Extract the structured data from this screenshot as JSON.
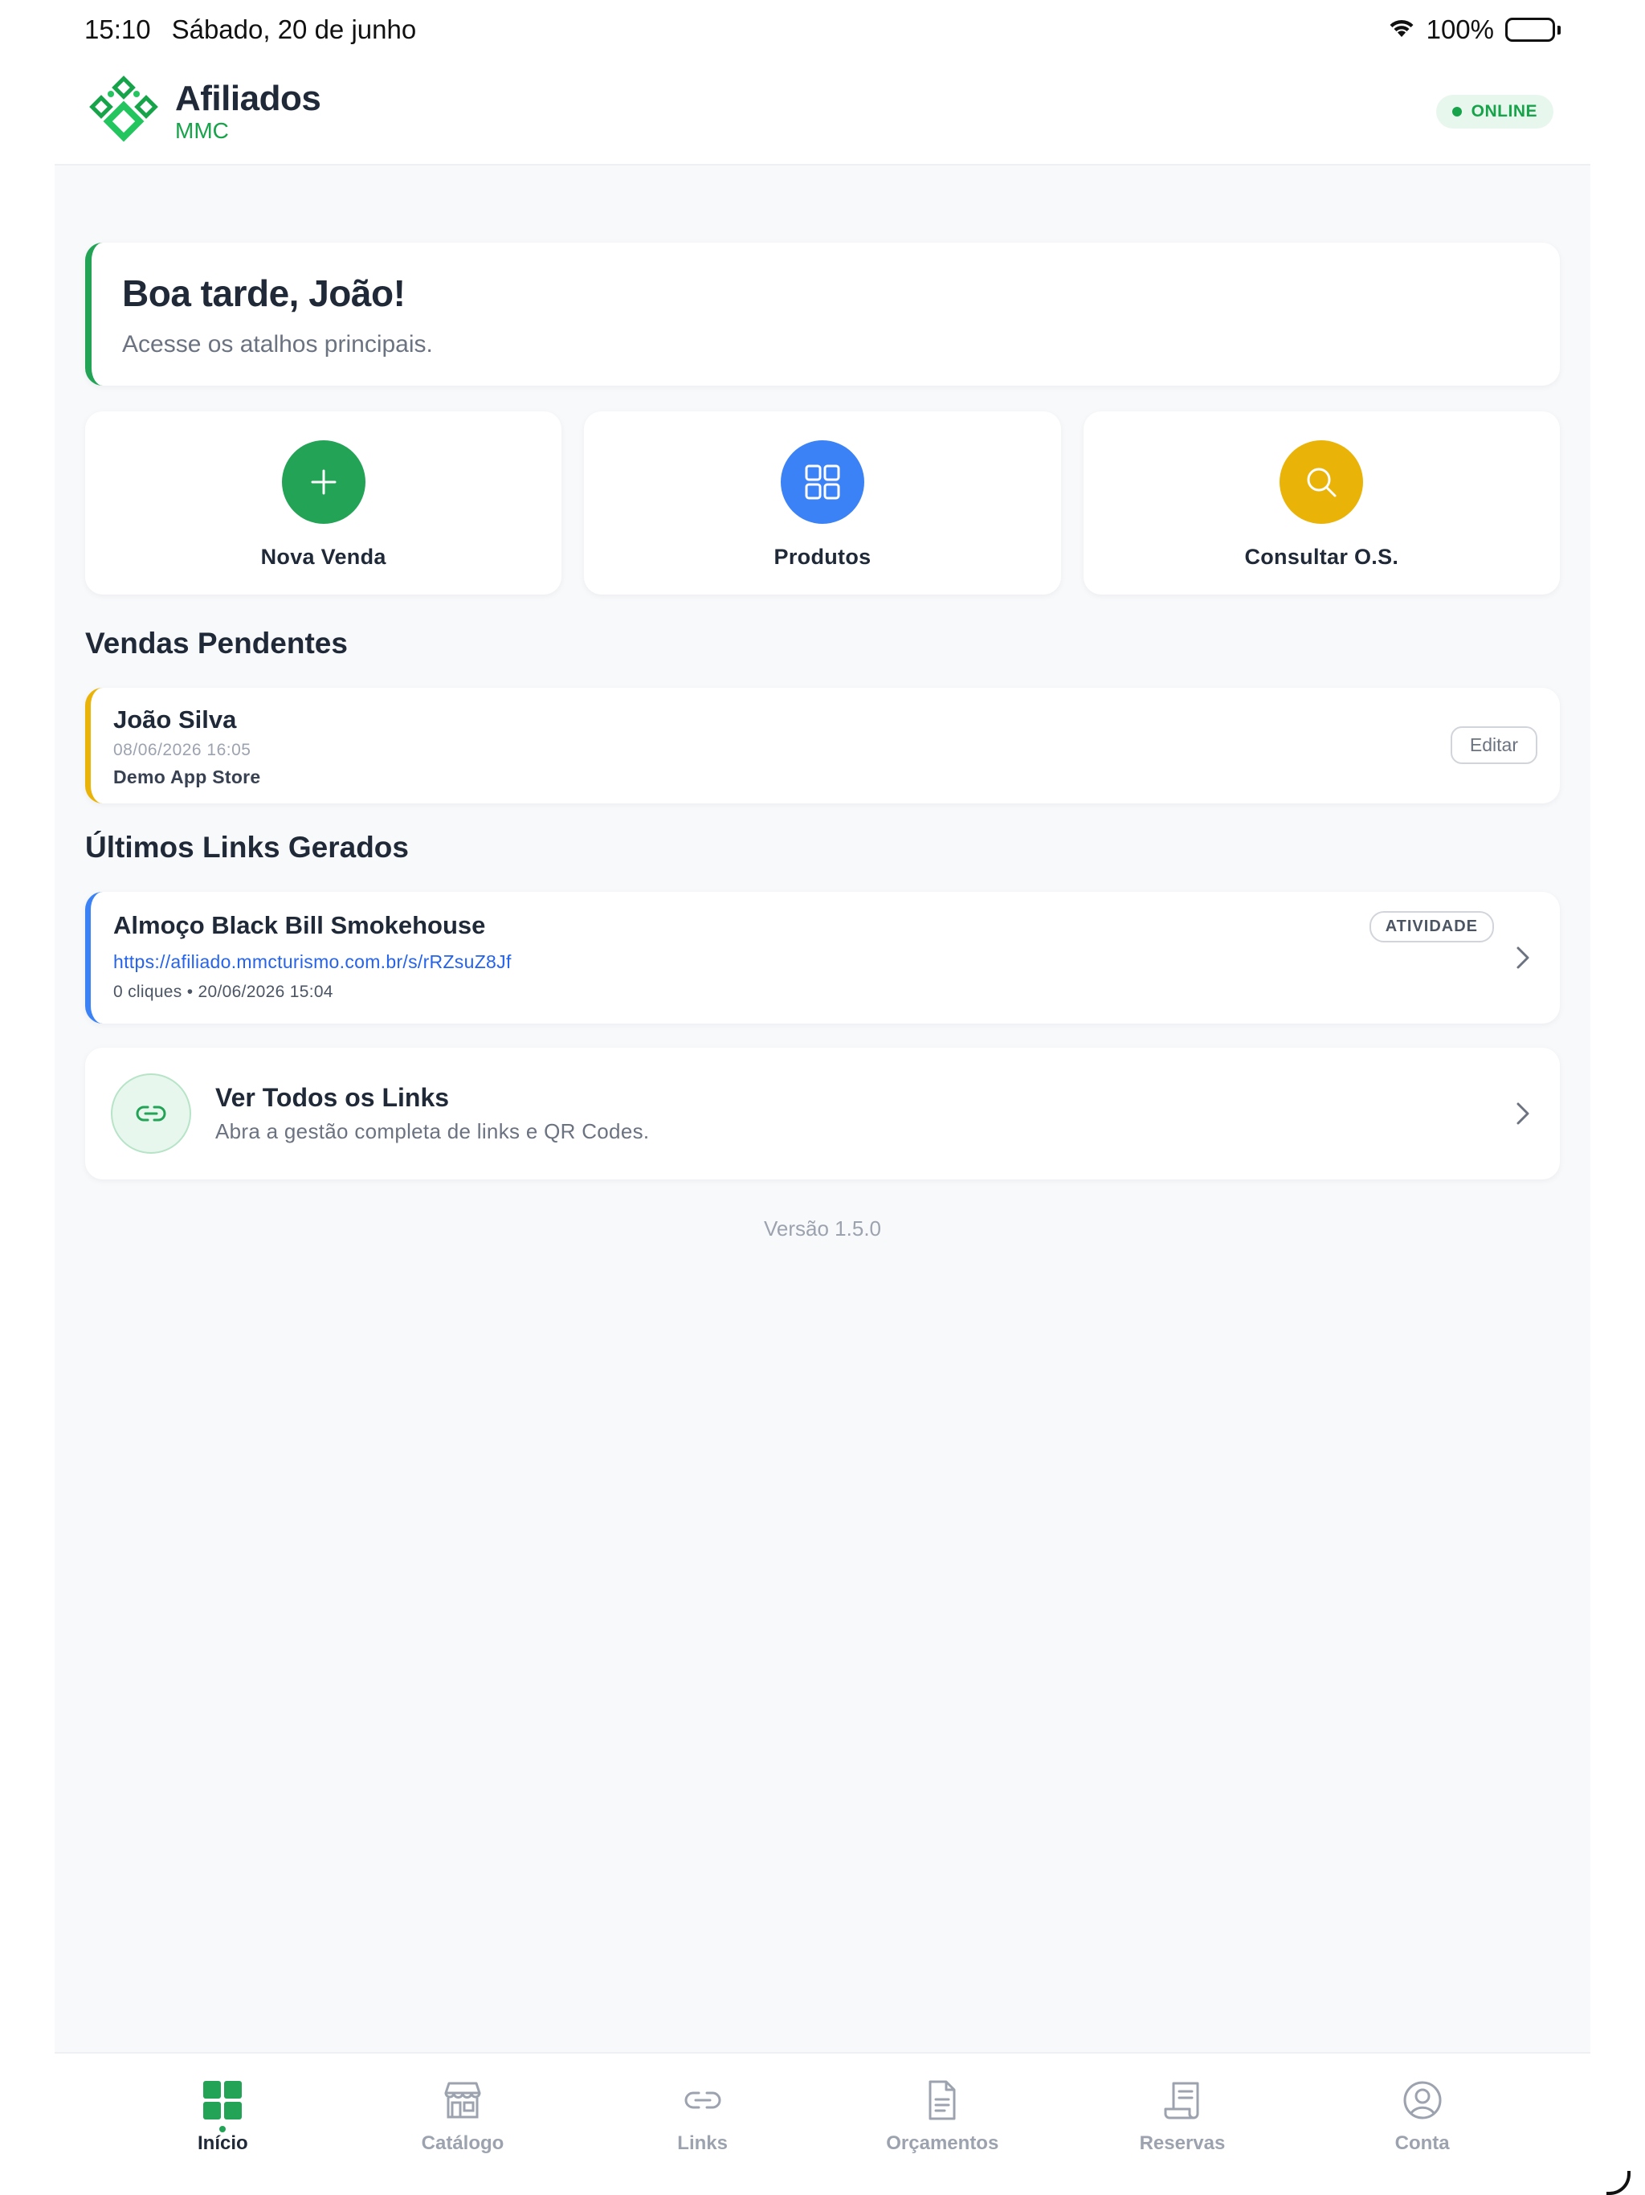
{
  "status_bar": {
    "time": "15:10",
    "date": "Sábado, 20 de junho",
    "battery": "100%"
  },
  "header": {
    "title": "Afiliados",
    "subtitle": "MMC",
    "status": "ONLINE"
  },
  "greeting": {
    "title": "Boa tarde, João!",
    "subtitle": "Acesse os atalhos principais."
  },
  "shortcuts": [
    {
      "label": "Nova Venda",
      "icon": "plus-icon",
      "color": "#22a355"
    },
    {
      "label": "Produtos",
      "icon": "grid-icon",
      "color": "#3b82f6"
    },
    {
      "label": "Consultar O.S.",
      "icon": "search-icon",
      "color": "#eab308"
    }
  ],
  "pending": {
    "section_title": "Vendas Pendentes",
    "items": [
      {
        "name": "João Silva",
        "date": "08/06/2026 16:05",
        "store": "Demo App Store",
        "action": "Editar"
      }
    ]
  },
  "links": {
    "section_title": "Últimos Links Gerados",
    "items": [
      {
        "title": "Almoço Black Bill Smokehouse",
        "url": "https://afiliado.mmcturismo.com.br/s/rRZsuZ8Jf",
        "meta": "0 cliques • 20/06/2026 15:04",
        "badge": "ATIVIDADE"
      }
    ],
    "view_all": {
      "title": "Ver Todos os Links",
      "subtitle": "Abra a gestão completa de links e QR Codes."
    }
  },
  "version": "Versão 1.5.0",
  "tabs": [
    {
      "label": "Início",
      "icon": "home-grid-icon",
      "active": true
    },
    {
      "label": "Catálogo",
      "icon": "store-icon",
      "active": false
    },
    {
      "label": "Links",
      "icon": "link-icon",
      "active": false
    },
    {
      "label": "Orçamentos",
      "icon": "document-icon",
      "active": false
    },
    {
      "label": "Reservas",
      "icon": "receipt-icon",
      "active": false
    },
    {
      "label": "Conta",
      "icon": "user-circle-icon",
      "active": false
    }
  ],
  "colors": {
    "brand_green": "#22a355",
    "link_blue": "#2563eb",
    "pending_yellow": "#eab308"
  }
}
